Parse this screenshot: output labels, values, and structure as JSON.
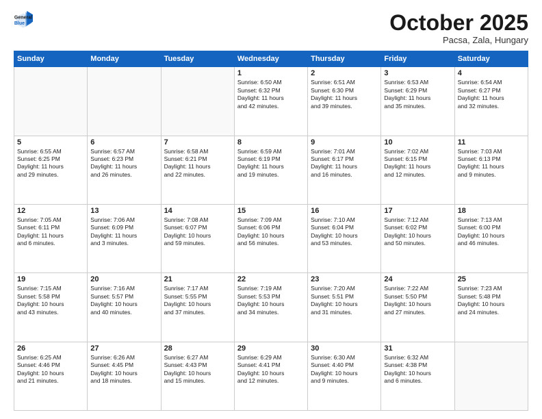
{
  "header": {
    "logo_line1": "General",
    "logo_line2": "Blue",
    "month": "October 2025",
    "location": "Pacsa, Zala, Hungary"
  },
  "days_of_week": [
    "Sunday",
    "Monday",
    "Tuesday",
    "Wednesday",
    "Thursday",
    "Friday",
    "Saturday"
  ],
  "weeks": [
    [
      {
        "day": "",
        "text": ""
      },
      {
        "day": "",
        "text": ""
      },
      {
        "day": "",
        "text": ""
      },
      {
        "day": "1",
        "text": "Sunrise: 6:50 AM\nSunset: 6:32 PM\nDaylight: 11 hours\nand 42 minutes."
      },
      {
        "day": "2",
        "text": "Sunrise: 6:51 AM\nSunset: 6:30 PM\nDaylight: 11 hours\nand 39 minutes."
      },
      {
        "day": "3",
        "text": "Sunrise: 6:53 AM\nSunset: 6:29 PM\nDaylight: 11 hours\nand 35 minutes."
      },
      {
        "day": "4",
        "text": "Sunrise: 6:54 AM\nSunset: 6:27 PM\nDaylight: 11 hours\nand 32 minutes."
      }
    ],
    [
      {
        "day": "5",
        "text": "Sunrise: 6:55 AM\nSunset: 6:25 PM\nDaylight: 11 hours\nand 29 minutes."
      },
      {
        "day": "6",
        "text": "Sunrise: 6:57 AM\nSunset: 6:23 PM\nDaylight: 11 hours\nand 26 minutes."
      },
      {
        "day": "7",
        "text": "Sunrise: 6:58 AM\nSunset: 6:21 PM\nDaylight: 11 hours\nand 22 minutes."
      },
      {
        "day": "8",
        "text": "Sunrise: 6:59 AM\nSunset: 6:19 PM\nDaylight: 11 hours\nand 19 minutes."
      },
      {
        "day": "9",
        "text": "Sunrise: 7:01 AM\nSunset: 6:17 PM\nDaylight: 11 hours\nand 16 minutes."
      },
      {
        "day": "10",
        "text": "Sunrise: 7:02 AM\nSunset: 6:15 PM\nDaylight: 11 hours\nand 12 minutes."
      },
      {
        "day": "11",
        "text": "Sunrise: 7:03 AM\nSunset: 6:13 PM\nDaylight: 11 hours\nand 9 minutes."
      }
    ],
    [
      {
        "day": "12",
        "text": "Sunrise: 7:05 AM\nSunset: 6:11 PM\nDaylight: 11 hours\nand 6 minutes."
      },
      {
        "day": "13",
        "text": "Sunrise: 7:06 AM\nSunset: 6:09 PM\nDaylight: 11 hours\nand 3 minutes."
      },
      {
        "day": "14",
        "text": "Sunrise: 7:08 AM\nSunset: 6:07 PM\nDaylight: 10 hours\nand 59 minutes."
      },
      {
        "day": "15",
        "text": "Sunrise: 7:09 AM\nSunset: 6:06 PM\nDaylight: 10 hours\nand 56 minutes."
      },
      {
        "day": "16",
        "text": "Sunrise: 7:10 AM\nSunset: 6:04 PM\nDaylight: 10 hours\nand 53 minutes."
      },
      {
        "day": "17",
        "text": "Sunrise: 7:12 AM\nSunset: 6:02 PM\nDaylight: 10 hours\nand 50 minutes."
      },
      {
        "day": "18",
        "text": "Sunrise: 7:13 AM\nSunset: 6:00 PM\nDaylight: 10 hours\nand 46 minutes."
      }
    ],
    [
      {
        "day": "19",
        "text": "Sunrise: 7:15 AM\nSunset: 5:58 PM\nDaylight: 10 hours\nand 43 minutes."
      },
      {
        "day": "20",
        "text": "Sunrise: 7:16 AM\nSunset: 5:57 PM\nDaylight: 10 hours\nand 40 minutes."
      },
      {
        "day": "21",
        "text": "Sunrise: 7:17 AM\nSunset: 5:55 PM\nDaylight: 10 hours\nand 37 minutes."
      },
      {
        "day": "22",
        "text": "Sunrise: 7:19 AM\nSunset: 5:53 PM\nDaylight: 10 hours\nand 34 minutes."
      },
      {
        "day": "23",
        "text": "Sunrise: 7:20 AM\nSunset: 5:51 PM\nDaylight: 10 hours\nand 31 minutes."
      },
      {
        "day": "24",
        "text": "Sunrise: 7:22 AM\nSunset: 5:50 PM\nDaylight: 10 hours\nand 27 minutes."
      },
      {
        "day": "25",
        "text": "Sunrise: 7:23 AM\nSunset: 5:48 PM\nDaylight: 10 hours\nand 24 minutes."
      }
    ],
    [
      {
        "day": "26",
        "text": "Sunrise: 6:25 AM\nSunset: 4:46 PM\nDaylight: 10 hours\nand 21 minutes."
      },
      {
        "day": "27",
        "text": "Sunrise: 6:26 AM\nSunset: 4:45 PM\nDaylight: 10 hours\nand 18 minutes."
      },
      {
        "day": "28",
        "text": "Sunrise: 6:27 AM\nSunset: 4:43 PM\nDaylight: 10 hours\nand 15 minutes."
      },
      {
        "day": "29",
        "text": "Sunrise: 6:29 AM\nSunset: 4:41 PM\nDaylight: 10 hours\nand 12 minutes."
      },
      {
        "day": "30",
        "text": "Sunrise: 6:30 AM\nSunset: 4:40 PM\nDaylight: 10 hours\nand 9 minutes."
      },
      {
        "day": "31",
        "text": "Sunrise: 6:32 AM\nSunset: 4:38 PM\nDaylight: 10 hours\nand 6 minutes."
      },
      {
        "day": "",
        "text": ""
      }
    ]
  ]
}
